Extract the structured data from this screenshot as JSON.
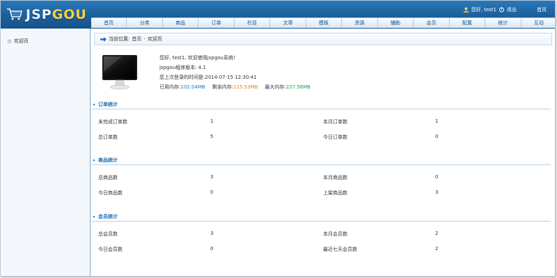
{
  "brand": {
    "part1": "JSP",
    "part2": "GOU"
  },
  "topbar": {
    "greeting": "您好, test1",
    "logout": "退出",
    "home": "首页"
  },
  "nav": [
    "首页",
    "分类",
    "商品",
    "订单",
    "栏目",
    "文章",
    "模板",
    "资源",
    "辅助",
    "会员",
    "配置",
    "统计",
    "互动"
  ],
  "sidebar": {
    "items": [
      {
        "label": "欢迎页"
      }
    ]
  },
  "breadcrumb": {
    "prefix": "当前位置:",
    "home": "首页",
    "sep": "-",
    "current": "欢迎页"
  },
  "welcome": {
    "line1": "您好, test1, 欢迎使用jspgou系统!",
    "version_label": "jspgou程序版本:",
    "version": "4.1",
    "last_login_label": "您上次登录的时间是:",
    "last_login": "2014-07-15 12:30:41",
    "used_mem_label": "已用内存:",
    "used_mem": "102.04MB",
    "free_mem_label": "剩余内存:",
    "free_mem": "125.53MB",
    "max_mem_label": "最大内存:",
    "max_mem": "227.56MB"
  },
  "sections": {
    "order": {
      "title": "订单统计",
      "rows": [
        [
          "未完成订单数",
          "1",
          "本月订单数",
          "1"
        ],
        [
          "总订单数",
          "5",
          "今日订单数",
          "0"
        ]
      ]
    },
    "product": {
      "title": "商品统计",
      "rows": [
        [
          "总商品数",
          "3",
          "本月商品数",
          "0"
        ],
        [
          "今日商品数",
          "0",
          "上架商品数",
          "3"
        ]
      ]
    },
    "member": {
      "title": "会员统计",
      "rows": [
        [
          "总会员数",
          "3",
          "本月会员数",
          "2"
        ],
        [
          "今日会员数",
          "0",
          "最近七天会员数",
          "2"
        ]
      ]
    }
  },
  "colors": {
    "header": "#1b5f9c",
    "accent": "#1a6cb3",
    "used_mem": "#1a7ac9",
    "free_mem": "#e8860e",
    "max_mem": "#13a14a"
  }
}
